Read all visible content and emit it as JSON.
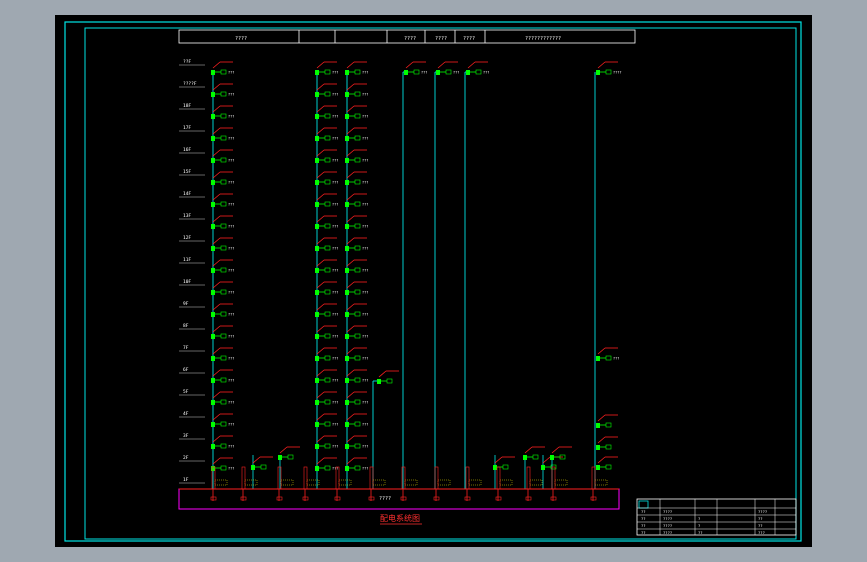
{
  "header": {
    "cells": [
      "????",
      "",
      "",
      "????",
      "????",
      "????",
      "????????????"
    ]
  },
  "left_floor_labels": [
    "??F",
    "????F",
    "18F",
    "17F",
    "16F",
    "15F",
    "14F",
    "13F",
    "12F",
    "11F",
    "10F",
    "9F",
    "8F",
    "7F",
    "6F",
    "5F",
    "4F",
    "3F",
    "2F",
    "1F"
  ],
  "riser_labels": {
    "r1": "???",
    "r2": "???",
    "r3": "???",
    "r4": "???",
    "r5": "???",
    "r6": "???",
    "r7": "????",
    "r7_mid": "???"
  },
  "bus_label": "????",
  "diagram_title": "配电系统图",
  "title_block": {
    "rows": [
      [
        "??",
        "????",
        "",
        "",
        "????"
      ],
      [
        "??",
        "????",
        "?",
        "",
        "??"
      ],
      [
        "??",
        "????",
        "?",
        "",
        "??"
      ],
      [
        "??",
        "????",
        "??",
        "",
        "???"
      ]
    ]
  },
  "colors": {
    "background": "#000000",
    "frame": "#00e5e5",
    "breaker": "#00ff00",
    "feeder": "#ff2020",
    "bus": "#ff00ff",
    "text": "#ffffff",
    "ui_chrome": "#9fa8b1"
  }
}
